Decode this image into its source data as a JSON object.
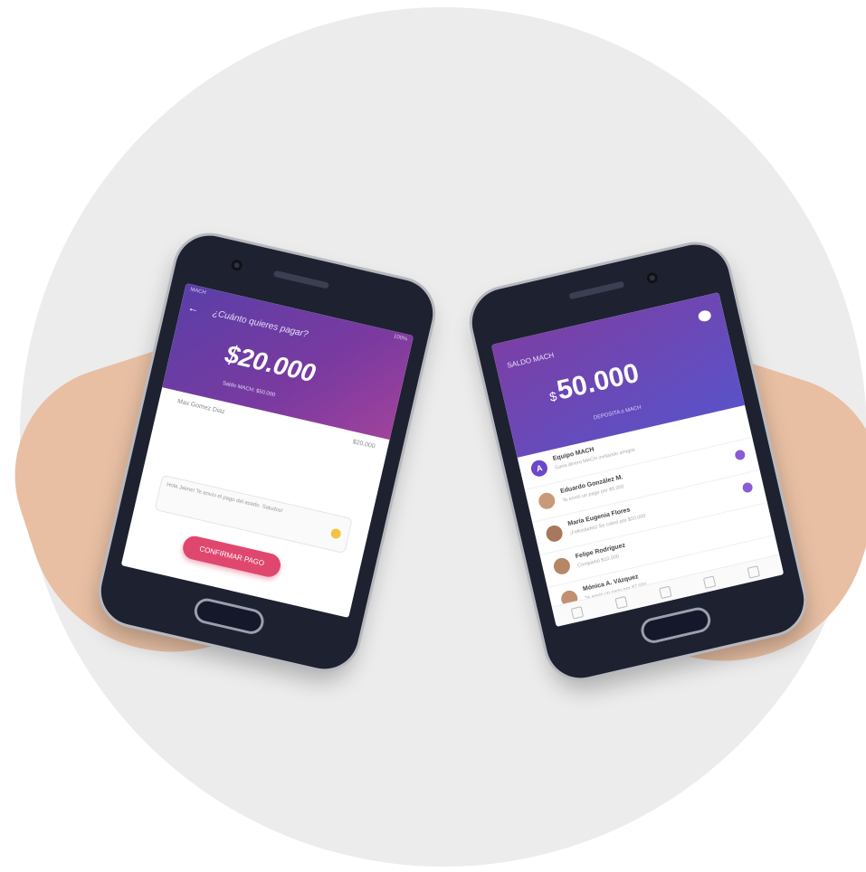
{
  "left_phone": {
    "status_left": "MACH",
    "status_right": "100%",
    "back_icon": "arrow-left-icon",
    "question": "¿Cuánto quieres pagar?",
    "amount": "$20.000",
    "subtitle": "Saldo MACH: $50.000",
    "payee_name": "Max Gomez Diaz",
    "payee_amount": "$20.000",
    "message": "Hola Jaime! Te envío el pago del asado. Saludos!",
    "confirm_label": "CONFIRMAR PAGO"
  },
  "right_phone": {
    "saldo_label": "SALDO MACH",
    "currency_symbol": "$",
    "balance": "50.000",
    "deposit_label": "DEPOSITA o MACH",
    "pig_icon": "piggy-bank-icon",
    "feed": [
      {
        "name": "Equipo MACH",
        "desc": "Gana dinero MACH invitando amigos"
      },
      {
        "name": "Eduardo González M.",
        "desc": "Te envió un pago por $5.000"
      },
      {
        "name": "María Eugenia Flores",
        "desc": "¡Felicidades! Se cobró por $20.000"
      },
      {
        "name": "Felipe Rodríguez",
        "desc": "Compartió $10.000"
      },
      {
        "name": "Mónica A. Vázquez",
        "desc": "Te envió un pago por $7.500"
      }
    ]
  }
}
